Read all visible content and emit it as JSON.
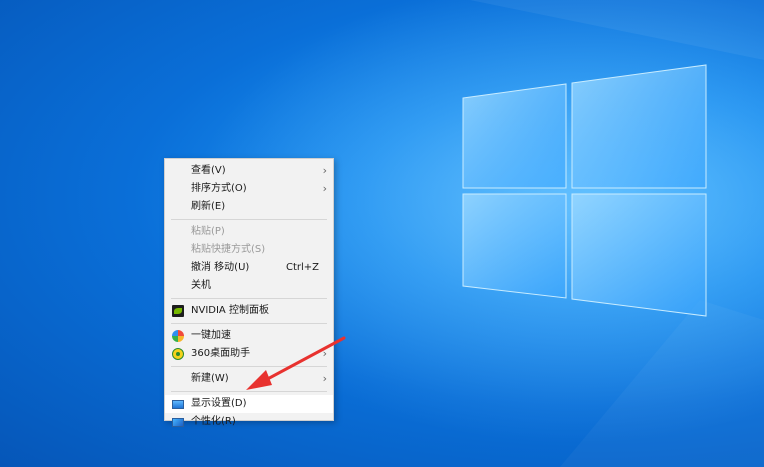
{
  "context_menu": {
    "items": [
      {
        "label": "查看(V)",
        "arrow": "›"
      },
      {
        "label": "排序方式(O)",
        "arrow": "›"
      },
      {
        "label": "刷新(E)"
      },
      {
        "label": "粘贴(P)"
      },
      {
        "label": "粘贴快捷方式(S)"
      },
      {
        "label": "撤消 移动(U)",
        "shortcut": "Ctrl+Z"
      },
      {
        "label": "关机"
      },
      {
        "label": "NVIDIA 控制面板",
        "icon": "nvidia-icon"
      },
      {
        "label": "一键加速",
        "icon": "speed-icon"
      },
      {
        "label": "360桌面助手",
        "icon": "helper-icon",
        "arrow": "›"
      },
      {
        "label": "新建(W)",
        "arrow": "›"
      },
      {
        "label": "显示设置(D)",
        "icon": "display-icon"
      },
      {
        "label": "个性化(R)",
        "icon": "personalize-icon"
      }
    ]
  },
  "colors": {
    "desktop_blue": "#0a6fd8",
    "menu_background": "#f2f2f2",
    "annotation_arrow": "#e8322f"
  }
}
